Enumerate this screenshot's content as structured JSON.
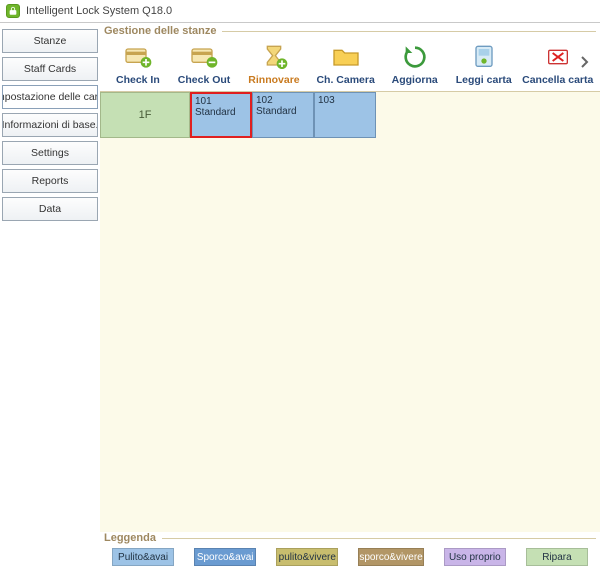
{
  "titlebar": {
    "title": "Intelligent Lock System Q18.0"
  },
  "sidebar": {
    "items": [
      {
        "label": "Stanze"
      },
      {
        "label": "Staff Cards"
      },
      {
        "label": "Impostazione delle carte"
      },
      {
        "label": "Informazioni di base."
      },
      {
        "label": "Settings"
      },
      {
        "label": "Reports"
      },
      {
        "label": "Data"
      }
    ]
  },
  "main": {
    "group_title": "Gestione delle stanze",
    "toolbar": [
      {
        "label": "Check In"
      },
      {
        "label": "Check Out"
      },
      {
        "label": "Rinnovare"
      },
      {
        "label": "Ch. Camera"
      },
      {
        "label": "Aggiorna"
      },
      {
        "label": "Leggi carta"
      },
      {
        "label": "Cancella carta"
      }
    ],
    "floor": "1F",
    "rooms": [
      {
        "num": "101",
        "type": "Standard",
        "selected": true
      },
      {
        "num": "102",
        "type": "Standard",
        "selected": false
      },
      {
        "num": "103",
        "type": "",
        "selected": false
      }
    ]
  },
  "legend": {
    "title": "Leggenda",
    "items": [
      {
        "label": "Pulito&avai",
        "cls": "sw-blue"
      },
      {
        "label": "Sporco&avai",
        "cls": "sw-dblue"
      },
      {
        "label": "pulito&vivere",
        "cls": "sw-olive"
      },
      {
        "label": "sporco&vivere",
        "cls": "sw-brown"
      },
      {
        "label": "Uso proprio",
        "cls": "sw-purple"
      },
      {
        "label": "Ripara",
        "cls": "sw-green"
      }
    ]
  }
}
